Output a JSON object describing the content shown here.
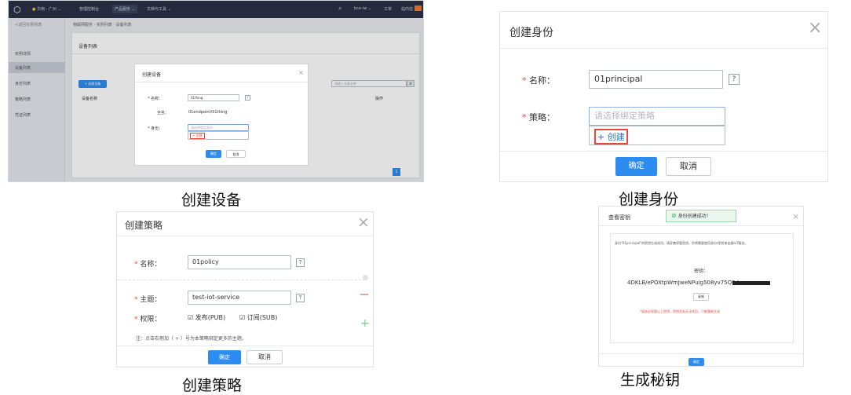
{
  "captions": {
    "c1": "创建设备",
    "c2": "创建身份",
    "c3": "创建策略",
    "c4": "生成秘钥"
  },
  "console": {
    "region": "华南 - 广州",
    "nav": [
      "管理控制台",
      "产品服务",
      "文档与工具"
    ],
    "top_right": [
      "bce-iw",
      "工单",
      "站内信"
    ],
    "back": "<返回实例列表",
    "breadcrumb": "物联网服务 · 实例列表 · 设备列表",
    "side_items": [
      "实例详情",
      "设备列表",
      "身份列表",
      "策略列表",
      "凭证列表"
    ],
    "list_title": "设备列表",
    "create_btn": "+ 创建设备",
    "search_placeholder": "请输入设备名称",
    "col_name": "设备名称",
    "col_op": "操作",
    "page": "1",
    "dialog": {
      "title": "创建设备",
      "name_label": "* 名称：",
      "name_value": "01thing",
      "fullname_label": "全名：",
      "fullname_value": "01endpoint/01thing",
      "identity_label": "* 身份：",
      "identity_placeholder": "请选择绑定身份",
      "create_link": "+ 创建",
      "ok": "确定",
      "cancel": "取消"
    }
  },
  "identity_dialog": {
    "title": "创建身份",
    "name_label": "名称：",
    "name_value": "01principal",
    "policy_label": "策略：",
    "policy_placeholder": "请选择绑定策略",
    "create_link": "+ 创建",
    "ok": "确定",
    "cancel": "取消",
    "help": "?"
  },
  "policy_dialog": {
    "title": "创建策略",
    "name_label": "名称：",
    "name_value": "01policy",
    "topic_label": "主题：",
    "topic_value": "test-iot-service",
    "perm_label": "权限：",
    "pub_label": "发布(PUB)",
    "sub_label": "订阅(SUB)",
    "note": "注：点击右侧加（ + ）号为本策略绑定更多的主题。",
    "ok": "确定",
    "cancel": "取消",
    "help": "?"
  },
  "key_dialog": {
    "title": "查看密钥",
    "toast": "身份创建成功！",
    "desc": "身份\"01principal\"的密钥生成成功，请妥善保管密钥，你将需要使用身份/密钥来连接IoT服务。",
    "key_label": "密钥：",
    "key_value": "4DKLB/ePOXtpWmJweNPuig508yv75Q9d",
    "copy": "复制",
    "warning": "*请务必保管以上密钥，密钥丢失无法找回，只能重新生成",
    "ok": "确定"
  }
}
